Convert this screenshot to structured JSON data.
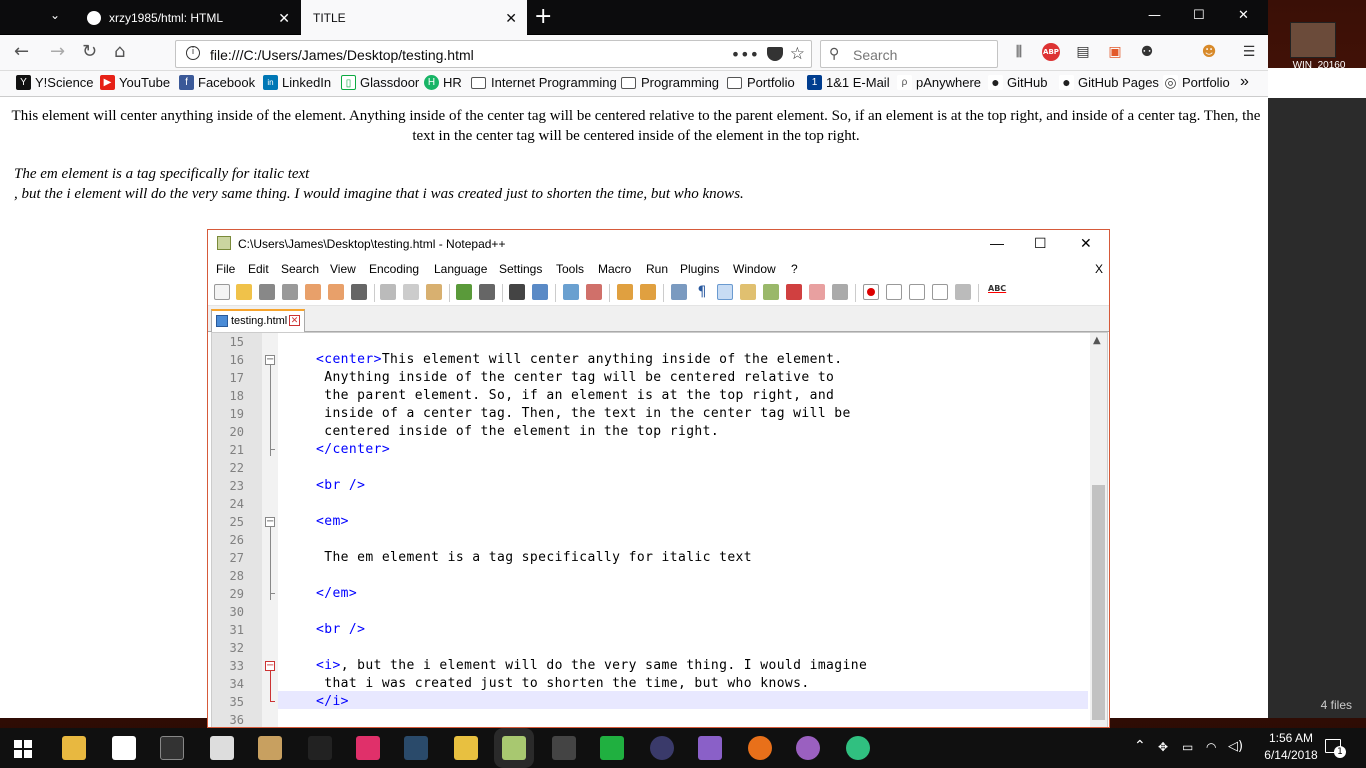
{
  "desktop": {
    "icon_label": "WIN_20160",
    "bg_window_files": "4 files"
  },
  "firefox": {
    "tabs": [
      {
        "label": "xrzy1985/html: HTML",
        "close": "✕"
      },
      {
        "label": "TITLE",
        "close": "✕"
      }
    ],
    "new_tab": "+",
    "url": "file:///C:/Users/James/Desktop/testing.html",
    "url_menu": "•••",
    "search_placeholder": "Search",
    "abp_label": "ABP",
    "bookmarks": [
      {
        "label": "Y!Science",
        "icon": "Y",
        "color": "#111111"
      },
      {
        "label": "YouTube",
        "icon": "▶",
        "color": "#e62117"
      },
      {
        "label": "Facebook",
        "icon": "f",
        "color": "#3b5998"
      },
      {
        "label": "LinkedIn",
        "icon": "in",
        "color": "#0077b5"
      },
      {
        "label": "Glassdoor",
        "icon": "▯",
        "color": "#0caa41"
      },
      {
        "label": "HR",
        "icon": "H",
        "color": "#18b466"
      },
      {
        "label": "Internet Programming",
        "icon": "folder",
        "color": ""
      },
      {
        "label": "Programming",
        "icon": "folder",
        "color": ""
      },
      {
        "label": "Portfolio",
        "icon": "folder",
        "color": ""
      },
      {
        "label": "1&1 E-Mail",
        "icon": "1",
        "color": "#003d8f"
      },
      {
        "label": "pAnywhere",
        "icon": "ρ",
        "color": "#555555"
      },
      {
        "label": "GitHub",
        "icon": "●",
        "color": "#222222"
      },
      {
        "label": "GitHub Pages",
        "icon": "●",
        "color": "#222222"
      },
      {
        "label": "Portfolio",
        "icon": "◎",
        "color": "#444444"
      }
    ],
    "bookmarks_overflow": "»"
  },
  "page": {
    "center_text": "This element will center anything inside of the element. Anything inside of the center tag will be centered relative to the parent element. So, if an element is at the top right, and inside of a center tag. Then, the text in the center tag will be centered inside of the element in the top right.",
    "em_text": "The em element is a tag specifically for italic text",
    "i_text": ", but the i element will do the very same thing. I would imagine that i was created just to shorten the time, but who knows."
  },
  "notepad": {
    "title": "C:\\Users\\James\\Desktop\\testing.html - Notepad++",
    "menu": [
      "File",
      "Edit",
      "Search",
      "View",
      "Encoding",
      "Language",
      "Settings",
      "Tools",
      "Macro",
      "Run",
      "Plugins",
      "Window",
      "?"
    ],
    "menu_close": "X",
    "tab_label": "testing.html",
    "tab_close": "✕",
    "spellcheck_label": "ABC",
    "lines": [
      {
        "n": "15",
        "tag": "",
        "text": ""
      },
      {
        "n": "16",
        "tag": "<center>",
        "text": "This element will center anything inside of the element."
      },
      {
        "n": "17",
        "tag": "",
        "text": " Anything inside of the center tag will be centered relative to"
      },
      {
        "n": "18",
        "tag": "",
        "text": " the parent element. So, if an element is at the top right, and"
      },
      {
        "n": "19",
        "tag": "",
        "text": " inside of a center tag. Then, the text in the center tag will be"
      },
      {
        "n": "20",
        "tag": "",
        "text": " centered inside of the element in the top right."
      },
      {
        "n": "21",
        "tag": "</center>",
        "text": ""
      },
      {
        "n": "22",
        "tag": "",
        "text": ""
      },
      {
        "n": "23",
        "tag": "<br />",
        "text": ""
      },
      {
        "n": "24",
        "tag": "",
        "text": ""
      },
      {
        "n": "25",
        "tag": "<em>",
        "text": ""
      },
      {
        "n": "26",
        "tag": "",
        "text": ""
      },
      {
        "n": "27",
        "tag": "",
        "text": " The em element is a tag specifically for italic text"
      },
      {
        "n": "28",
        "tag": "",
        "text": ""
      },
      {
        "n": "29",
        "tag": "</em>",
        "text": ""
      },
      {
        "n": "30",
        "tag": "",
        "text": ""
      },
      {
        "n": "31",
        "tag": "<br />",
        "text": ""
      },
      {
        "n": "32",
        "tag": "",
        "text": ""
      },
      {
        "n": "33",
        "tag": "<i>",
        "text": ", but the i element will do the very same thing. I would imagine"
      },
      {
        "n": "34",
        "tag": "",
        "text": " that i was created just to shorten the time, but who knows."
      },
      {
        "n": "35",
        "tag": "</i>",
        "text": ""
      },
      {
        "n": "36",
        "tag": "",
        "text": ""
      }
    ]
  },
  "taskbar": {
    "time": "1:56 AM",
    "date": "6/14/2018",
    "notification_count": "1"
  }
}
